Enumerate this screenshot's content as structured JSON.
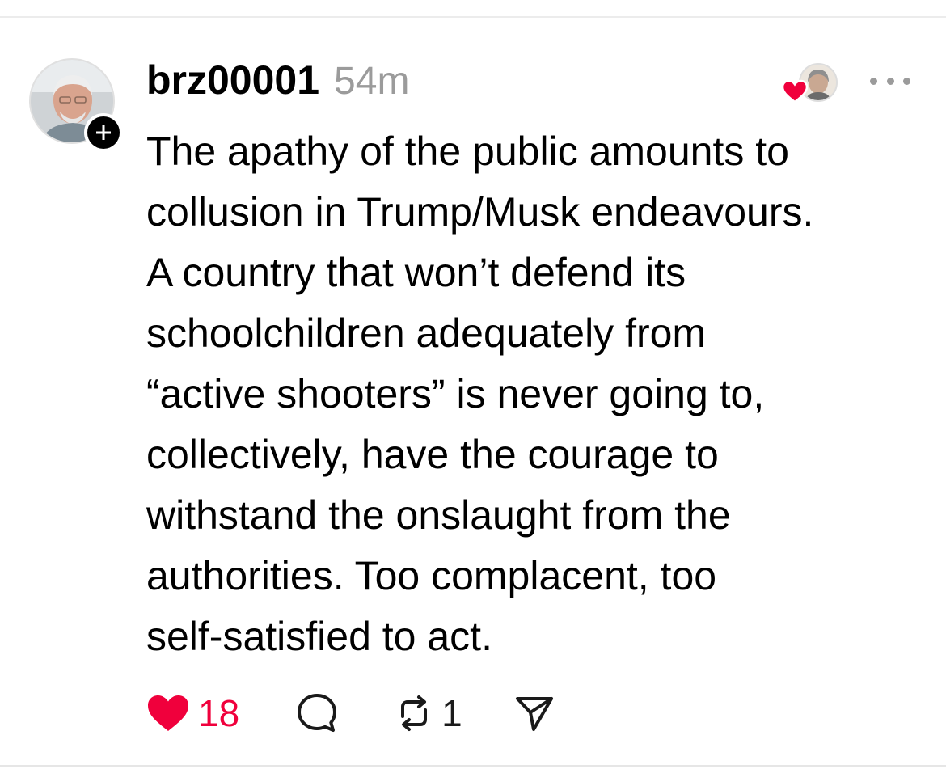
{
  "post": {
    "author": {
      "username": "brz00001",
      "avatar_icon": "user-avatar"
    },
    "timestamp": "54m",
    "follow_icon": "plus-icon",
    "text": "The apathy of the public amounts to\ncollusion in Trump/Musk endeavours.\nA country that won’t defend its\nschoolchildren adequately from\n“active shooters” is never going to,\ncollectively, have the courage to\nwithstand the onslaught from the\nauthorities.  Too complacent, too\nself-satisfied to act.",
    "liked_by_icon": "liker-avatar",
    "more_icon": "more-options-icon",
    "actions": {
      "like_icon": "heart-icon",
      "like_count": "18",
      "like_color": "#f0003c",
      "reply_icon": "comment-icon",
      "repost_icon": "repost-icon",
      "repost_count": "1",
      "share_icon": "send-icon"
    }
  }
}
